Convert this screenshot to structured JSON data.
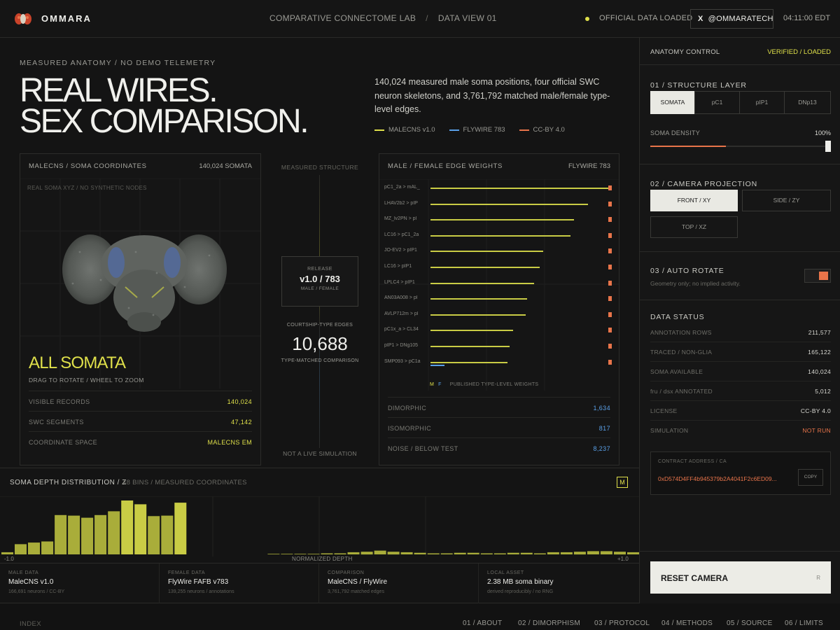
{
  "header": {
    "brand": "OMMARA",
    "crumb_lab": "COMPARATIVE CONNECTOME LAB",
    "crumb_sep": "/",
    "crumb_view": "DATA VIEW 01",
    "status": "OFFICIAL DATA LOADED",
    "x_icon": "X",
    "x_handle": "@OMMARATECH",
    "clock": "04:11:00 EDT"
  },
  "hero": {
    "kicker": "MEASURED ANATOMY / NO DEMO TELEMETRY",
    "title_line1": "REAL WIRES.",
    "title_line2": "SEX COMPARISON.",
    "description": "140,024 measured male soma positions, four official SWC neuron skeletons, and 3,761,792 matched male/female type-level edges.",
    "legend": [
      {
        "label": "MALECNS v1.0",
        "color": "#dfe04a"
      },
      {
        "label": "FLYWIRE 783",
        "color": "#5aa0e8"
      },
      {
        "label": "CC-BY 4.0",
        "color": "#e8744a"
      }
    ]
  },
  "brain_panel": {
    "title": "MALECNS / SOMA COORDINATES",
    "count": "140,024 SOMATA",
    "subtitle": "REAL SOMA XYZ / NO SYNTHETIC NODES",
    "heading": "ALL SOMATA",
    "hint": "DRAG TO ROTATE / WHEEL TO ZOOM",
    "rows": [
      {
        "label": "VISIBLE RECORDS",
        "value": "140,024"
      },
      {
        "label": "SWC SEGMENTS",
        "value": "47,142"
      },
      {
        "label": "COORDINATE SPACE",
        "value": "MALECNS EM"
      }
    ]
  },
  "middle": {
    "top_label": "MEASURED STRUCTURE",
    "release_label": "RELEASE",
    "release_value": "v1.0 / 783",
    "release_sub": "MALE / FEMALE",
    "courtship_label": "COURTSHIP-TYPE EDGES",
    "courtship_value": "10,688",
    "courtship_sub": "TYPE-MATCHED COMPARISON",
    "bottom_label": "NOT A LIVE SIMULATION"
  },
  "edge_panel": {
    "title": "MALE / FEMALE EDGE WEIGHTS",
    "source": "FLYWIRE 783",
    "key_m": "M",
    "key_f": "F",
    "key_text": "PUBLISHED TYPE-LEVEL WEIGHTS",
    "colors": {
      "male": "#c9cc45",
      "female": "#5aa0e8",
      "marker": "#e8744a"
    },
    "rows": [
      {
        "label": "pC1_2a > mAL_",
        "male": 1.0,
        "female": 0.0
      },
      {
        "label": "LHAV2b2 > pIP",
        "male": 0.88,
        "female": 0.0
      },
      {
        "label": "MZ_lv2PN > pl",
        "male": 0.8,
        "female": 0.0
      },
      {
        "label": "LC16 > pC1_2a",
        "male": 0.78,
        "female": 0.0
      },
      {
        "label": "JO-EV2 > pIP1",
        "male": 0.63,
        "female": 0.0
      },
      {
        "label": "LC16 > pIP1",
        "male": 0.61,
        "female": 0.0
      },
      {
        "label": "LPLC4 > pIP1",
        "male": 0.58,
        "female": 0.0
      },
      {
        "label": "AN03A008 > pl",
        "male": 0.54,
        "female": 0.0
      },
      {
        "label": "AVLP712m > pl",
        "male": 0.53,
        "female": 0.0
      },
      {
        "label": "pC1x_a > CL34",
        "male": 0.46,
        "female": 0.0
      },
      {
        "label": "pIP1 > DNg105",
        "male": 0.44,
        "female": 0.0
      },
      {
        "label": "SMP093 > pC1a",
        "male": 0.43,
        "female": 0.08
      }
    ],
    "stats": [
      {
        "label": "DIMORPHIC",
        "value": "1,634"
      },
      {
        "label": "ISOMORPHIC",
        "value": "817"
      },
      {
        "label": "NOISE / BELOW TEST",
        "value": "8,237"
      }
    ]
  },
  "depth": {
    "title": "SOMA DEPTH DISTRIBUTION / Z",
    "subtitle": "48 BINS / MEASURED COORDINATES",
    "mode_button": "M",
    "axis_min": "-1.0",
    "axis_mid": "NORMALIZED DEPTH",
    "axis_max": "+1.0",
    "chart_data": {
      "type": "bar",
      "bins": 48,
      "x_range": [
        -1.0,
        1.0
      ],
      "xlabel": "NORMALIZED DEPTH",
      "values": [
        0.04,
        0.19,
        0.22,
        0.24,
        0.73,
        0.72,
        0.68,
        0.73,
        0.8,
        1.0,
        0.93,
        0.71,
        0.72,
        0.96,
        0.0,
        0.0,
        0.0,
        0.0,
        0.0,
        0.0,
        0.01,
        0.01,
        0.01,
        0.01,
        0.02,
        0.02,
        0.04,
        0.05,
        0.07,
        0.05,
        0.04,
        0.03,
        0.02,
        0.02,
        0.03,
        0.03,
        0.02,
        0.02,
        0.03,
        0.03,
        0.02,
        0.04,
        0.04,
        0.05,
        0.06,
        0.06,
        0.05,
        0.04
      ],
      "colors": {
        "bar": "#a9ad3a",
        "bar_bright": "#c9cc45"
      }
    }
  },
  "sources": [
    {
      "key": "MALE DATA",
      "value": "MaleCNS v1.0",
      "sub": "166,691 neurons / CC-BY"
    },
    {
      "key": "FEMALE DATA",
      "value": "FlyWire FAFB v783",
      "sub": "139,255 neurons / annotations"
    },
    {
      "key": "COMPARISON",
      "value": "MaleCNS / FlyWire",
      "sub": "3,761,792 matched edges"
    },
    {
      "key": "LOCAL ASSET",
      "value": "2.38 MB soma binary",
      "sub": "derived reproducibly / no RNG"
    }
  ],
  "footer": {
    "index": "INDEX",
    "links": [
      "01 / ABOUT",
      "02 / DIMORPHISM",
      "03 / PROTOCOL",
      "04 / METHODS",
      "05 / SOURCE",
      "06 / LIMITS"
    ]
  },
  "sidebar": {
    "title": "ANATOMY CONTROL",
    "status": "VERIFIED / LOADED",
    "structure_title": "01 / STRUCTURE LAYER",
    "structure_options": [
      "SOMATA",
      "pC1",
      "pIP1",
      "DNp13"
    ],
    "structure_selected": "SOMATA",
    "density_label": "SOMA DENSITY",
    "density_value": "100%",
    "density_fraction": 1.0,
    "camera_title": "02 / CAMERA PROJECTION",
    "camera_options": [
      "FRONT / XY",
      "SIDE / ZY",
      "TOP / XZ"
    ],
    "camera_selected": "FRONT / XY",
    "rotate_title": "03 / AUTO ROTATE",
    "rotate_sub": "Geometry only; no implied activity.",
    "data_title": "DATA STATUS",
    "data_rows": [
      {
        "label": "ANNOTATION ROWS",
        "value": "211,577"
      },
      {
        "label": "TRACED / NON-GLIA",
        "value": "165,122"
      },
      {
        "label": "SOMA AVAILABLE",
        "value": "140,024"
      },
      {
        "label": "fru / dsx ANNOTATED",
        "value": "5,012"
      },
      {
        "label": "LICENSE",
        "value": "CC-BY 4.0"
      },
      {
        "label": "SIMULATION",
        "value": "NOT RUN"
      }
    ],
    "ca_label": "CONTRACT ADDRESS / CA",
    "ca_value": "0xD574D4FF4b945379b2A4041F2c6ED09...",
    "copy_label": "COPY",
    "reset_label": "RESET CAMERA",
    "reset_key": "R",
    "accent": "#e8744a"
  }
}
